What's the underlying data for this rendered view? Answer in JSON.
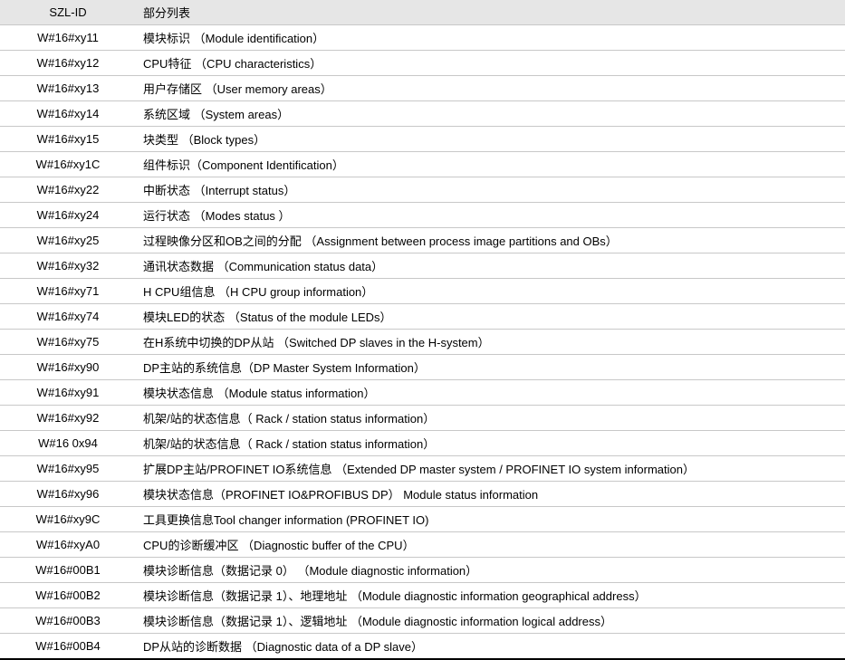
{
  "headers": {
    "col1": "SZL-ID",
    "col2": "部分列表"
  },
  "rows": [
    {
      "id": "W#16#xy11",
      "desc": "模块标识 （Module identification）"
    },
    {
      "id": "W#16#xy12",
      "desc": "CPU特征 （CPU characteristics）"
    },
    {
      "id": "W#16#xy13",
      "desc": "用户存储区 （User memory areas）"
    },
    {
      "id": "W#16#xy14",
      "desc": "系统区域 （System areas）"
    },
    {
      "id": "W#16#xy15",
      "desc": "块类型 （Block types）"
    },
    {
      "id": "W#16#xy1C",
      "desc": "组件标识（Component Identification）"
    },
    {
      "id": "W#16#xy22",
      "desc": "中断状态 （Interrupt status）"
    },
    {
      "id": "W#16#xy24",
      "desc": "运行状态 （Modes status ）"
    },
    {
      "id": "W#16#xy25",
      "desc": "过程映像分区和OB之间的分配 （Assignment between process image partitions and OBs）"
    },
    {
      "id": "W#16#xy32",
      "desc": "通讯状态数据 （Communication status data）"
    },
    {
      "id": "W#16#xy71",
      "desc": "H CPU组信息 （H CPU group information）"
    },
    {
      "id": "W#16#xy74",
      "desc": "模块LED的状态 （Status of the module LEDs）"
    },
    {
      "id": "W#16#xy75",
      "desc": "在H系统中切换的DP从站 （Switched DP slaves in the H-system）"
    },
    {
      "id": "W#16#xy90",
      "desc": "DP主站的系统信息（DP Master System Information）"
    },
    {
      "id": "W#16#xy91",
      "desc": "模块状态信息 （Module status information）"
    },
    {
      "id": "W#16#xy92",
      "desc": "机架/站的状态信息（ Rack / station status information）"
    },
    {
      "id": "W#16 0x94",
      "desc": "机架/站的状态信息（ Rack / station status information）"
    },
    {
      "id": "W#16#xy95",
      "desc": "扩展DP主站/PROFINET IO系统信息 （Extended DP master system / PROFINET IO system information）"
    },
    {
      "id": "W#16#xy96",
      "desc": "模块状态信息（PROFINET IO&PROFIBUS DP） Module status information"
    },
    {
      "id": "W#16#xy9C",
      "desc": "工具更换信息Tool changer information (PROFINET IO)"
    },
    {
      "id": "W#16#xyA0",
      "desc": "CPU的诊断缓冲区 （Diagnostic buffer of the CPU）"
    },
    {
      "id": "W#16#00B1",
      "desc": "模块诊断信息（数据记录 0） （Module diagnostic information）"
    },
    {
      "id": "W#16#00B2",
      "desc": "模块诊断信息（数据记录 1）、地理地址 （Module diagnostic information geographical address）"
    },
    {
      "id": "W#16#00B3",
      "desc": "模块诊断信息（数据记录 1）、逻辑地址 （Module diagnostic information logical address）"
    },
    {
      "id": "W#16#00B4",
      "desc": "DP从站的诊断数据 （Diagnostic data of a DP slave）"
    }
  ]
}
